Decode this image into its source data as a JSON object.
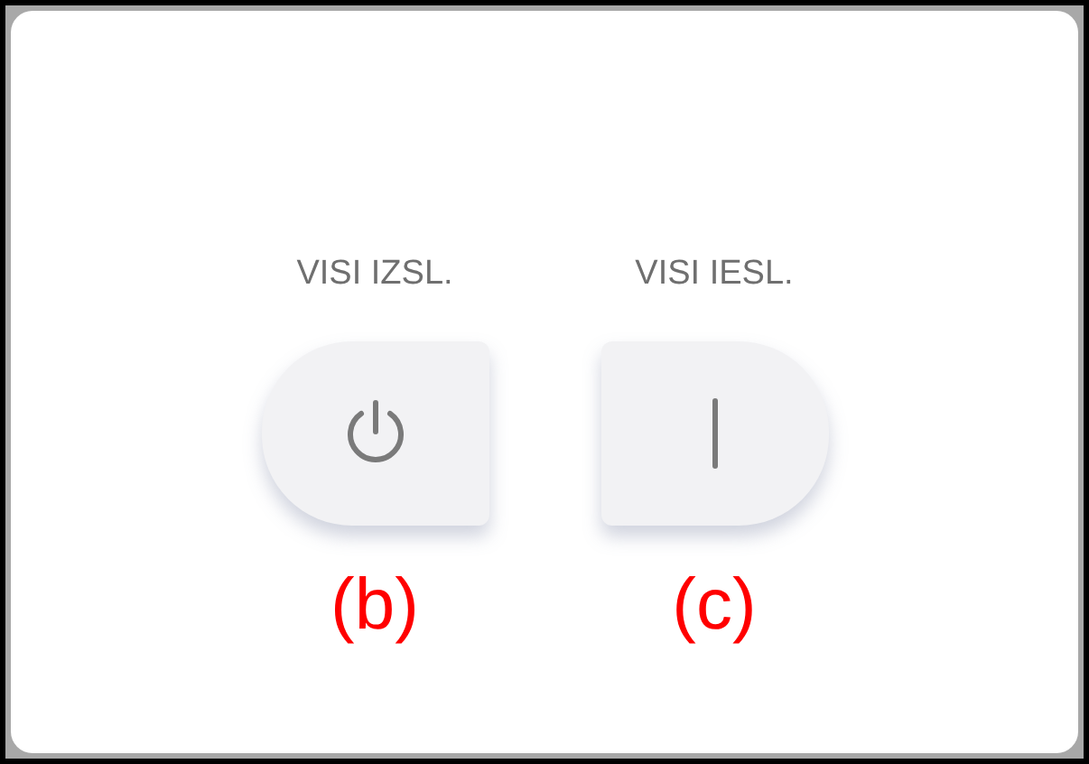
{
  "buttons": [
    {
      "label": "VISI IZSL.",
      "kind": "power",
      "caption": "(b)"
    },
    {
      "label": "VISI IESL.",
      "kind": "on",
      "caption": "(c)"
    }
  ]
}
